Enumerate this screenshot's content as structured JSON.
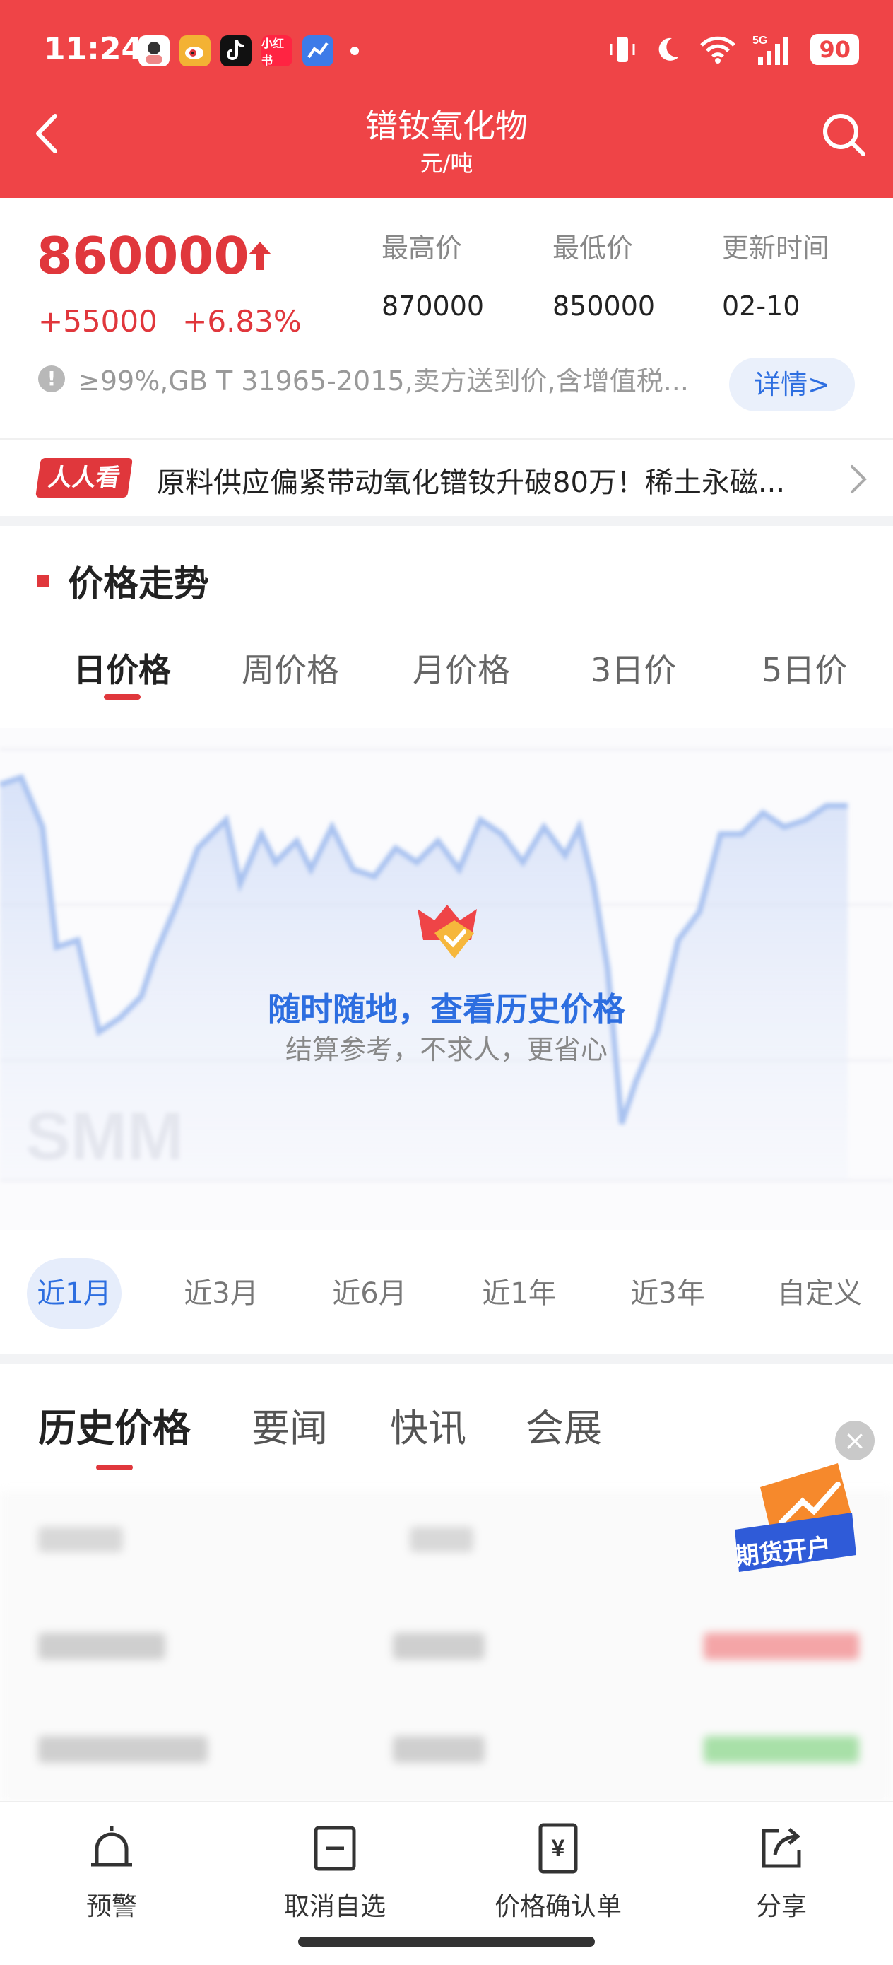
{
  "status_bar": {
    "time": "11:24",
    "notification_icons": [
      "portrait-app-icon",
      "weibo-icon",
      "tiktok-icon",
      "xiaohongshu-icon",
      "map-app-icon"
    ],
    "xiaohongshu_label": "小红书",
    "battery": "90",
    "network": "5G"
  },
  "header": {
    "title": "镨钕氧化物",
    "subtitle": "元/吨",
    "color": "#ef4447"
  },
  "price": {
    "current": "860000",
    "change_abs": "+55000",
    "change_pct": "+6.83%",
    "high_label": "最高价",
    "high_value": "870000",
    "low_label": "最低价",
    "low_value": "850000",
    "update_label": "更新时间",
    "update_value": "02-10",
    "note": "≥99%,GB T 31965-2015,卖方送到价,含增值税...",
    "detail_label": "详情>"
  },
  "news": {
    "tag": "人人看",
    "headline": "原料供应偏紧带动氧化镨钕升破80万！稀土永磁..."
  },
  "trend": {
    "section_title": "价格走势",
    "period_tabs": [
      "日价格",
      "周价格",
      "月价格",
      "3日价",
      "5日价"
    ],
    "active_period": 0,
    "overlay_title": "随时随地，查看历史价格",
    "overlay_subtitle": "结算参考，不求人，更省心",
    "range_tabs": [
      "近1月",
      "近3月",
      "近6月",
      "近1年",
      "近3年",
      "自定义"
    ],
    "active_range": 0
  },
  "tabs": {
    "items": [
      "历史价格",
      "要闻",
      "快讯",
      "会展"
    ],
    "active": 0
  },
  "ad": {
    "label": "期货开户"
  },
  "bottom_bar": {
    "items": [
      "预警",
      "取消自选",
      "价格确认单",
      "分享"
    ]
  }
}
